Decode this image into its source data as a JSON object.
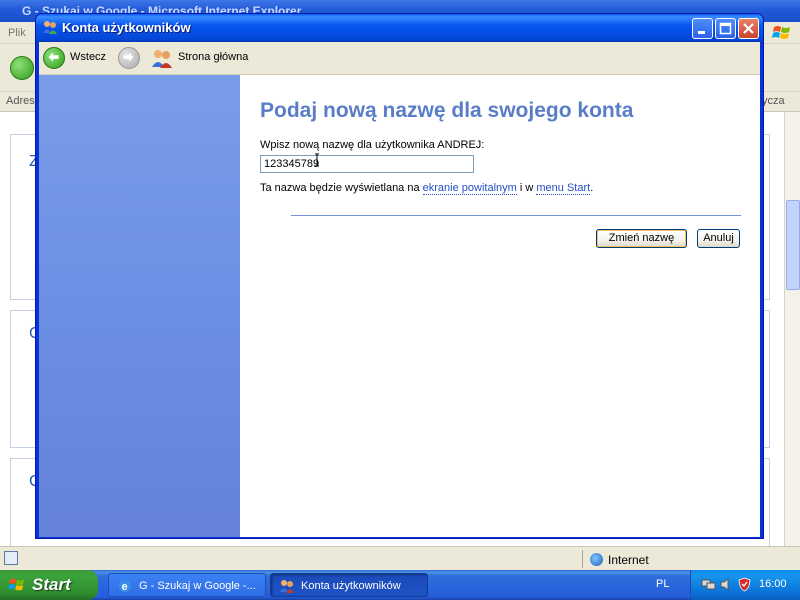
{
  "background_window": {
    "title": "G - Szukaj w Google - Microsoft Internet Explorer",
    "menu_first": "Plik",
    "address_label": "Adres",
    "address_right": "ycza",
    "page_letters": [
      "Z",
      "C",
      "C"
    ]
  },
  "statusbar": {
    "zone": "Internet"
  },
  "dialog": {
    "title": "Konta użytkowników",
    "nav": {
      "back": "Wstecz",
      "home": "Strona główna"
    },
    "heading": "Podaj nową nazwę dla swojego konta",
    "prompt": "Wpisz nową nazwę dla użytkownika ANDREJ:",
    "input_value": "123345789",
    "info": {
      "prefix": "Ta nazwa będzie wyświetlana na ",
      "link1": "ekranie powitalnym",
      "middle": " i w ",
      "link2": "menu Start",
      "suffix": "."
    },
    "buttons": {
      "change": "Zmień nazwę",
      "cancel": "Anuluj"
    }
  },
  "taskbar": {
    "start": "Start",
    "tasks": [
      "G - Szukaj w Google -...",
      "Konta użytkowników"
    ],
    "language": "PL",
    "clock": "16:00"
  },
  "icons": [
    "ie-icon",
    "windows-flag-icon",
    "back-arrow-icon",
    "forward-arrow-icon",
    "users-icon",
    "text-cursor-icon",
    "globe-icon",
    "security-shield-icon"
  ]
}
